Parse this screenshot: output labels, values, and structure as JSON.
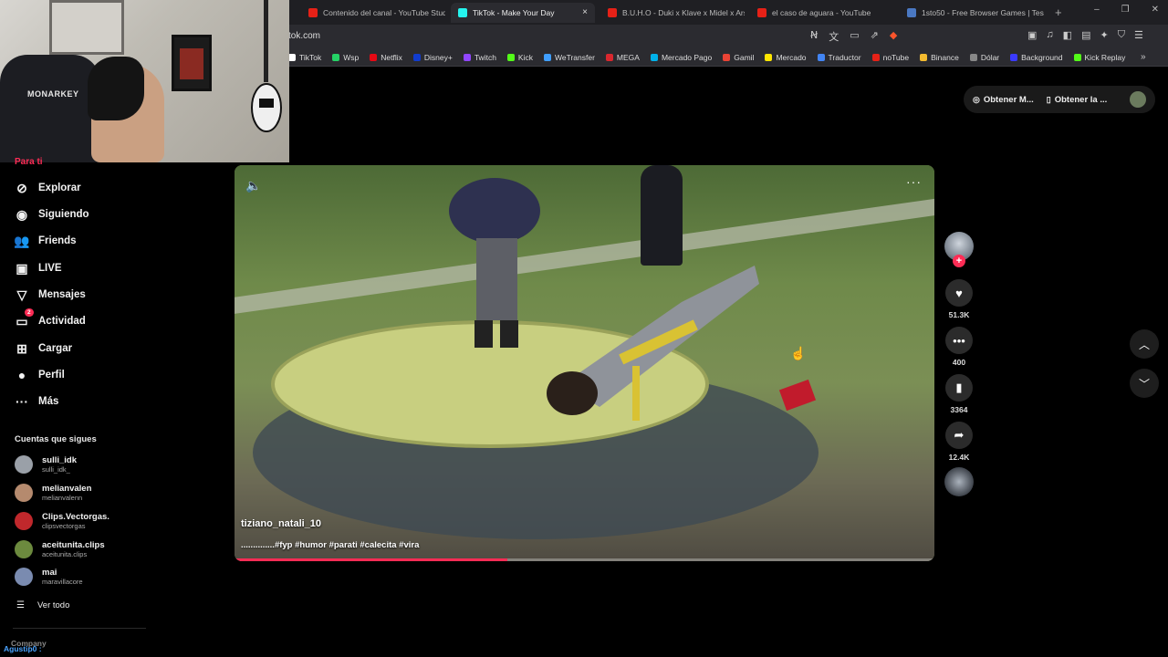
{
  "browser": {
    "tabs": [
      {
        "title": "Contenido del canal - YouTube Studi",
        "color": "#e62117",
        "active": false
      },
      {
        "title": "TikTok - Make Your Day",
        "color": "#25f4ee",
        "active": true
      },
      {
        "title": "B.U.H.O - Duki x Klave x Midel x Ars",
        "color": "#e62117",
        "active": false
      },
      {
        "title": "el caso de aguara - YouTube",
        "color": "#e62117",
        "active": false
      },
      {
        "title": "1sto50 - Free Browser Games | Test",
        "color": "#4a78c2",
        "active": false
      }
    ],
    "close_tab": "×",
    "new_tab": "+",
    "window_controls": [
      "–",
      "❐",
      "✕"
    ],
    "url": "tok.com",
    "bookmarks": [
      {
        "label": "TikTok",
        "color": "#ffffff"
      },
      {
        "label": "Wsp",
        "color": "#25d366"
      },
      {
        "label": "Netflix",
        "color": "#e50914"
      },
      {
        "label": "Disney+",
        "color": "#113ccf"
      },
      {
        "label": "Twitch",
        "color": "#9146ff"
      },
      {
        "label": "Kick",
        "color": "#53fc18"
      },
      {
        "label": "WeTransfer",
        "color": "#409fff"
      },
      {
        "label": "MEGA",
        "color": "#d9272e"
      },
      {
        "label": "Mercado Pago",
        "color": "#00b1ea"
      },
      {
        "label": "Gamil",
        "color": "#ea4335"
      },
      {
        "label": "Mercado",
        "color": "#ffe600"
      },
      {
        "label": "Traductor",
        "color": "#4285f4"
      },
      {
        "label": "noTube",
        "color": "#e62117"
      },
      {
        "label": "Binance",
        "color": "#f3ba2f"
      },
      {
        "label": "Dólar",
        "color": "#888888"
      },
      {
        "label": "Background",
        "color": "#3a3aff"
      },
      {
        "label": "Kick Replay",
        "color": "#53fc18"
      }
    ],
    "bookmarks_more": "»"
  },
  "webcam": {
    "chair_brand": "MONARKEY"
  },
  "sidebar": {
    "partial_item": "Para ti",
    "items": [
      {
        "label": "Explorar",
        "icon": "compass-icon",
        "glyph": "⊘"
      },
      {
        "label": "Siguiendo",
        "icon": "following-icon",
        "glyph": "◉"
      },
      {
        "label": "Friends",
        "icon": "friends-icon",
        "glyph": "👥"
      },
      {
        "label": "LIVE",
        "icon": "live-icon",
        "glyph": "▣"
      },
      {
        "label": "Mensajes",
        "icon": "messages-icon",
        "glyph": "▽"
      },
      {
        "label": "Actividad",
        "icon": "activity-icon",
        "glyph": "▭",
        "badge": "2"
      },
      {
        "label": "Cargar",
        "icon": "upload-icon",
        "glyph": "⊞"
      },
      {
        "label": "Perfil",
        "icon": "profile-icon",
        "glyph": "●"
      },
      {
        "label": "Más",
        "icon": "more-icon",
        "glyph": "···"
      }
    ],
    "following_title": "Cuentas que sigues",
    "accounts": [
      {
        "name": "sulli_idk",
        "handle": "sulli_idk_",
        "color": "#9aa0a8"
      },
      {
        "name": "melianvalen",
        "handle": "melianvalenn",
        "color": "#b58a6e"
      },
      {
        "name": "Clips.Vectorgas.",
        "handle": "clipsvectorgas",
        "color": "#c0282c"
      },
      {
        "name": "aceitunita.clips",
        "handle": "aceitunita.clips",
        "color": "#6c8a3e"
      },
      {
        "name": "mai",
        "handle": "maravillacore",
        "color": "#7a8bb0"
      }
    ],
    "see_all": "Ver todo",
    "company": "Company",
    "overlay_name": "Agustip0 :"
  },
  "top_actions": {
    "btn1": "Obtener M...",
    "btn2": "Obtener la ..."
  },
  "video": {
    "author": "tiziano_natali_10",
    "description": "..............#fyp #humor #parati #calecita #vira",
    "progress": 0.39
  },
  "actions": {
    "likes": "51.3K",
    "comments": "400",
    "saves": "3364",
    "shares": "12.4K"
  },
  "colors": {
    "accent": "#fe2c55"
  }
}
